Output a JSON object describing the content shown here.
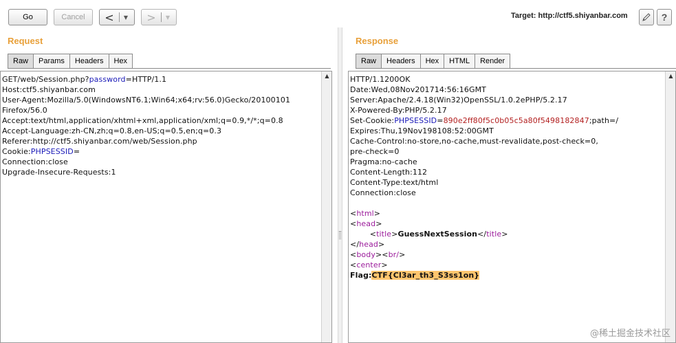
{
  "toolbar": {
    "go_label": "Go",
    "cancel_label": "Cancel",
    "back_glyph": "<",
    "forward_glyph": ">",
    "dropdown_glyph": "▼",
    "target_text": "Target: http://ctf5.shiyanbar.com",
    "edit_icon": "pencil-icon",
    "help_label": "?"
  },
  "request": {
    "title": "Request",
    "tabs": [
      "Raw",
      "Params",
      "Headers",
      "Hex"
    ],
    "active_tab": "Raw",
    "lines": [
      {
        "parts": [
          {
            "t": "GET/web/Session.php?"
          },
          {
            "t": "password",
            "c": "blue"
          },
          {
            "t": "=HTTP/1.1"
          }
        ]
      },
      {
        "parts": [
          {
            "t": "Host:ctf5.shiyanbar.com"
          }
        ]
      },
      {
        "parts": [
          {
            "t": "User-Agent:Mozilla/5.0(WindowsNT6.1;Win64;x64;rv:56.0)Gecko/20100101"
          }
        ]
      },
      {
        "parts": [
          {
            "t": "Firefox/56.0"
          }
        ]
      },
      {
        "parts": [
          {
            "t": "Accept:text/html,application/xhtml+xml,application/xml;q=0.9,*/*;q=0.8"
          }
        ]
      },
      {
        "parts": [
          {
            "t": "Accept-Language:zh-CN,zh;q=0.8,en-US;q=0.5,en;q=0.3"
          }
        ]
      },
      {
        "parts": [
          {
            "t": "Referer:http://ctf5.shiyanbar.com/web/Session.php"
          }
        ]
      },
      {
        "parts": [
          {
            "t": "Cookie:"
          },
          {
            "t": "PHPSESSID",
            "c": "blue"
          },
          {
            "t": "="
          }
        ]
      },
      {
        "parts": [
          {
            "t": "Connection:close"
          }
        ]
      },
      {
        "parts": [
          {
            "t": "Upgrade-Insecure-Requests:1"
          }
        ]
      }
    ]
  },
  "response": {
    "title": "Response",
    "tabs": [
      "Raw",
      "Headers",
      "Hex",
      "HTML",
      "Render"
    ],
    "active_tab": "Raw",
    "lines": [
      {
        "parts": [
          {
            "t": "HTTP/1.1200OK"
          }
        ]
      },
      {
        "parts": [
          {
            "t": "Date:Wed,08Nov201714:56:16GMT"
          }
        ]
      },
      {
        "parts": [
          {
            "t": "Server:Apache/2.4.18(Win32)OpenSSL/1.0.2ePHP/5.2.17"
          }
        ]
      },
      {
        "parts": [
          {
            "t": "X-Powered-By:PHP/5.2.17"
          }
        ]
      },
      {
        "parts": [
          {
            "t": "Set-Cookie:"
          },
          {
            "t": "PHPSESSID",
            "c": "blue"
          },
          {
            "t": "="
          },
          {
            "t": "890e2ff80f5c0b05c5a80f5498182847",
            "c": "red"
          },
          {
            "t": ";path=/"
          }
        ]
      },
      {
        "parts": [
          {
            "t": "Expires:Thu,19Nov198108:52:00GMT"
          }
        ]
      },
      {
        "parts": [
          {
            "t": "Cache-Control:no-store,no-cache,must-revalidate,post-check=0,"
          }
        ]
      },
      {
        "parts": [
          {
            "t": "pre-check=0"
          }
        ]
      },
      {
        "parts": [
          {
            "t": "Pragma:no-cache"
          }
        ]
      },
      {
        "parts": [
          {
            "t": "Content-Length:112"
          }
        ]
      },
      {
        "parts": [
          {
            "t": "Content-Type:text/html"
          }
        ]
      },
      {
        "parts": [
          {
            "t": "Connection:close"
          }
        ]
      },
      {
        "parts": [
          {
            "t": ""
          }
        ]
      },
      {
        "parts": [
          {
            "t": "<"
          },
          {
            "t": "html",
            "c": "purple"
          },
          {
            "t": ">"
          }
        ]
      },
      {
        "parts": [
          {
            "t": "<"
          },
          {
            "t": "head",
            "c": "purple"
          },
          {
            "t": ">"
          }
        ]
      },
      {
        "parts": [
          {
            "t": "        <"
          },
          {
            "t": "title",
            "c": "purple"
          },
          {
            "t": ">"
          },
          {
            "t": "GuessNextSession",
            "c": "flag"
          },
          {
            "t": "</"
          },
          {
            "t": "title",
            "c": "purple"
          },
          {
            "t": ">"
          }
        ]
      },
      {
        "parts": [
          {
            "t": "</"
          },
          {
            "t": "head",
            "c": "purple"
          },
          {
            "t": ">"
          }
        ]
      },
      {
        "parts": [
          {
            "t": "<"
          },
          {
            "t": "body",
            "c": "purple"
          },
          {
            "t": "><"
          },
          {
            "t": "br/",
            "c": "purple"
          },
          {
            "t": ">"
          }
        ]
      },
      {
        "parts": [
          {
            "t": "<"
          },
          {
            "t": "center",
            "c": "purple"
          },
          {
            "t": ">"
          }
        ]
      },
      {
        "parts": [
          {
            "t": "Flag:",
            "c": "flag"
          },
          {
            "t": "CTF{Cl3ar_th3_S3ss1on}",
            "c": "hl"
          }
        ]
      }
    ]
  },
  "watermark": "@稀土掘金技术社区",
  "colors": {
    "pane_title": "#e8a03a",
    "highlight": "#ffc56e",
    "param_blue": "#1a1ab8",
    "cookie_red": "#b32020",
    "tag_purple": "#9b1b9b"
  }
}
